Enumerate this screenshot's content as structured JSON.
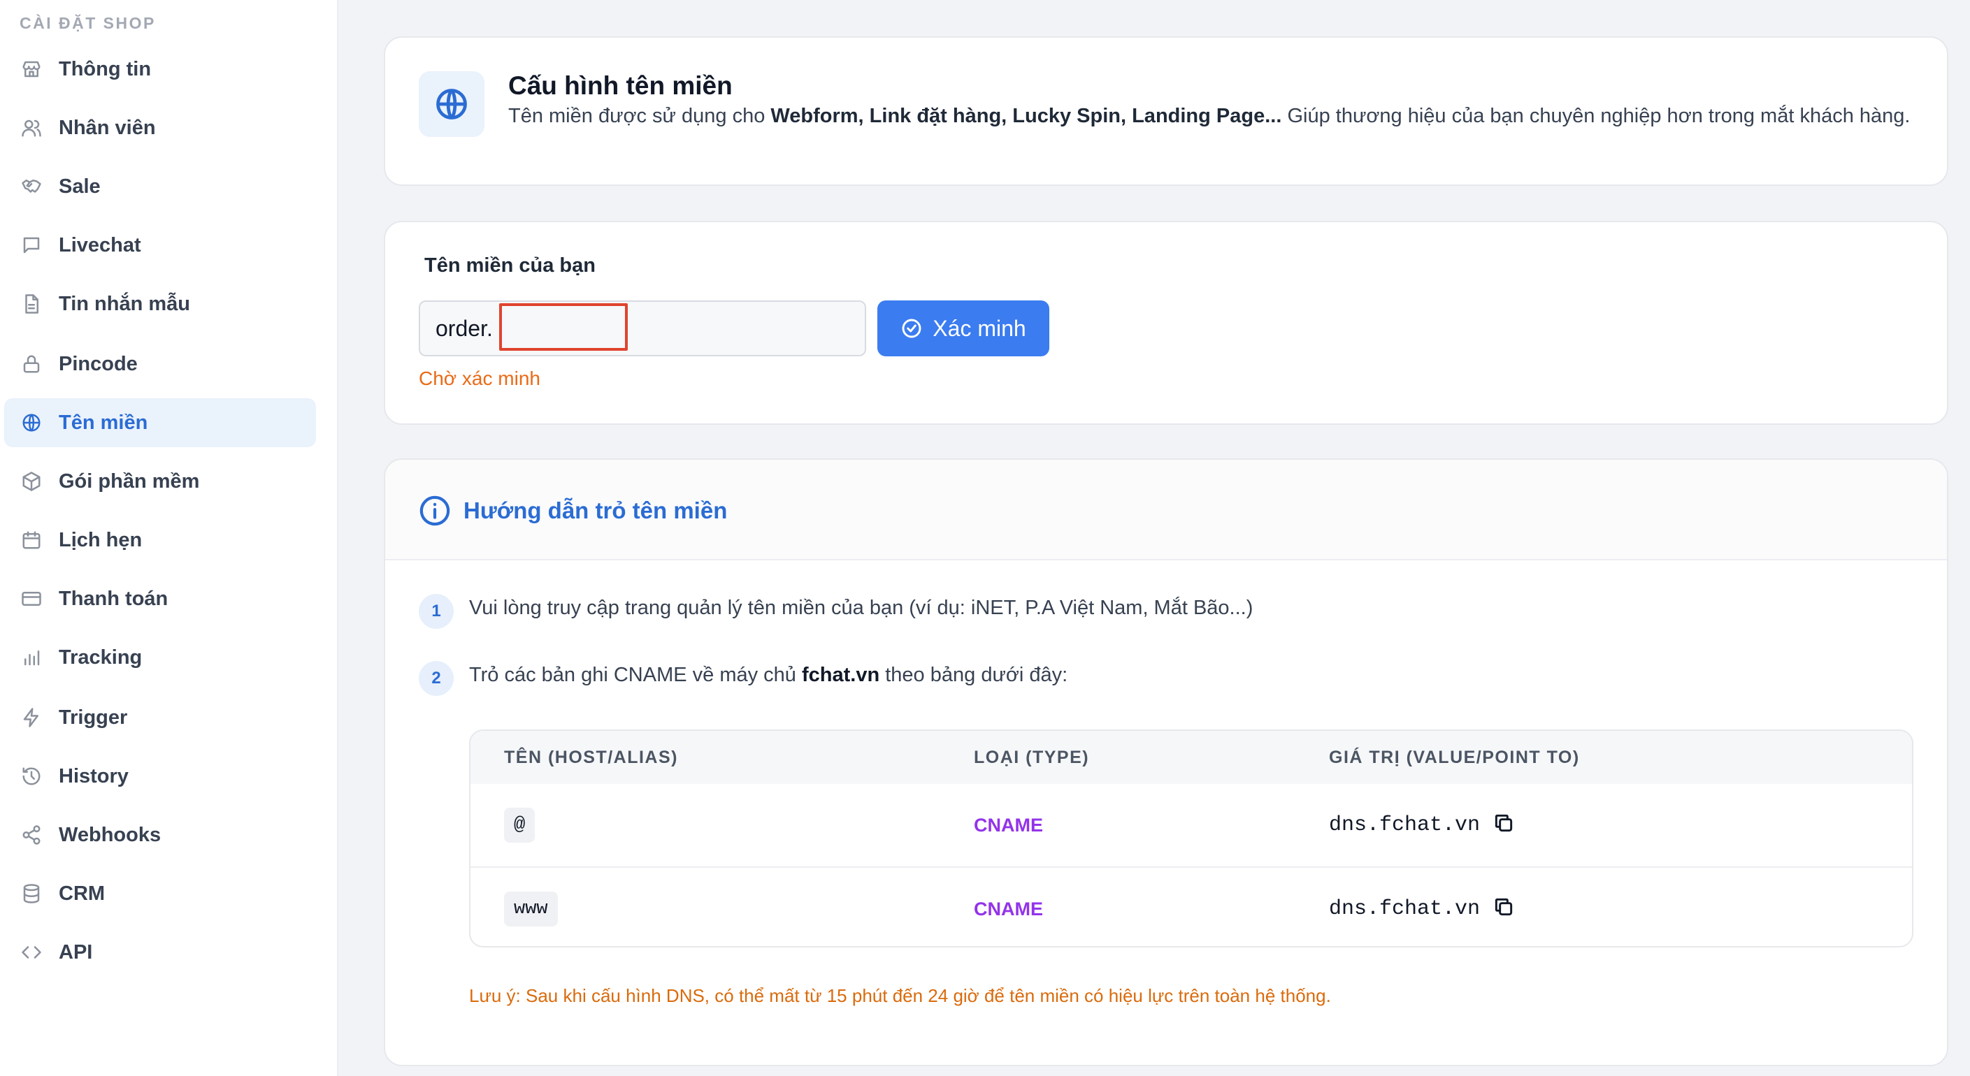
{
  "sidebar": {
    "title": "CÀI ĐẶT SHOP",
    "items": [
      {
        "label": "Thông tin",
        "icon": "store-icon"
      },
      {
        "label": "Nhân viên",
        "icon": "users-icon"
      },
      {
        "label": "Sale",
        "icon": "handshake-icon"
      },
      {
        "label": "Livechat",
        "icon": "chat-icon"
      },
      {
        "label": "Tin nhắn mẫu",
        "icon": "document-icon"
      },
      {
        "label": "Pincode",
        "icon": "lock-icon"
      },
      {
        "label": "Tên miền",
        "icon": "globe-icon",
        "active": true
      },
      {
        "label": "Gói phần mềm",
        "icon": "package-icon"
      },
      {
        "label": "Lịch hẹn",
        "icon": "calendar-icon"
      },
      {
        "label": "Thanh toán",
        "icon": "credit-card-icon"
      },
      {
        "label": "Tracking",
        "icon": "bar-chart-icon"
      },
      {
        "label": "Trigger",
        "icon": "lightning-icon"
      },
      {
        "label": "History",
        "icon": "history-icon"
      },
      {
        "label": "Webhooks",
        "icon": "webhook-icon"
      },
      {
        "label": "CRM",
        "icon": "database-icon"
      },
      {
        "label": "API",
        "icon": "code-icon"
      }
    ]
  },
  "header_card": {
    "title": "Cấu hình tên miền",
    "desc_prefix": "Tên miền được sử dụng cho ",
    "desc_bold": "Webform, Link đặt hàng, Lucky Spin, Landing Page...",
    "desc_suffix": " Giúp thương hiệu của bạn chuyên nghiệp hơn trong mắt khách hàng."
  },
  "domain_card": {
    "label": "Tên miền của bạn",
    "input_value": "order.",
    "verify_label": "Xác minh",
    "status": "Chờ xác minh"
  },
  "guide": {
    "title": "Hướng dẫn trỏ tên miền",
    "step1_num": "1",
    "step1_text": "Vui lòng truy cập trang quản lý tên miền của bạn (ví dụ: iNET, P.A Việt Nam, Mắt Bão...)",
    "step2_num": "2",
    "step2_prefix": "Trỏ các bản ghi CNAME về máy chủ ",
    "step2_bold": "fchat.vn",
    "step2_suffix": " theo bảng dưới đây:",
    "table": {
      "headers": [
        "TÊN (HOST/ALIAS)",
        "LOẠI (TYPE)",
        "GIÁ TRỊ (VALUE/POINT TO)"
      ],
      "rows": [
        {
          "host": "@",
          "type": "CNAME",
          "value": "dns.fchat.vn"
        },
        {
          "host": "www",
          "type": "CNAME",
          "value": "dns.fchat.vn"
        }
      ]
    },
    "note": "Lưu ý: Sau khi cấu hình DNS, có thể mất từ 15 phút đến 24 giờ để tên miền có hiệu lực trên toàn hệ thống."
  },
  "colors": {
    "accent": "#2b6cd3",
    "button": "#3b7cf0",
    "pending": "#ea6a17",
    "cname": "#9333ea"
  }
}
